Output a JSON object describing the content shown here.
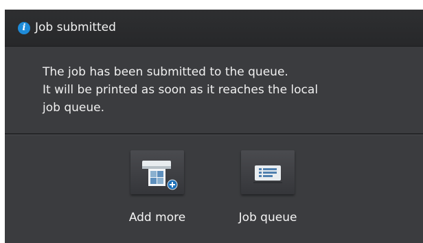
{
  "dialog": {
    "title": "Job submitted",
    "title_icon": "info-icon",
    "message_lines": [
      "The job has been submitted to the queue.",
      "It will be printed as soon as it reaches the local",
      "job queue."
    ]
  },
  "actions": [
    {
      "label": "Add more",
      "icon": "add-more-printer-icon"
    },
    {
      "label": "Job queue",
      "icon": "job-queue-icon"
    }
  ],
  "colors": {
    "dialog_background": "#3b3c3f",
    "title_bar": "#2a2b2d",
    "info_icon": "#1e8bd8",
    "text": "#f0f0f0"
  }
}
